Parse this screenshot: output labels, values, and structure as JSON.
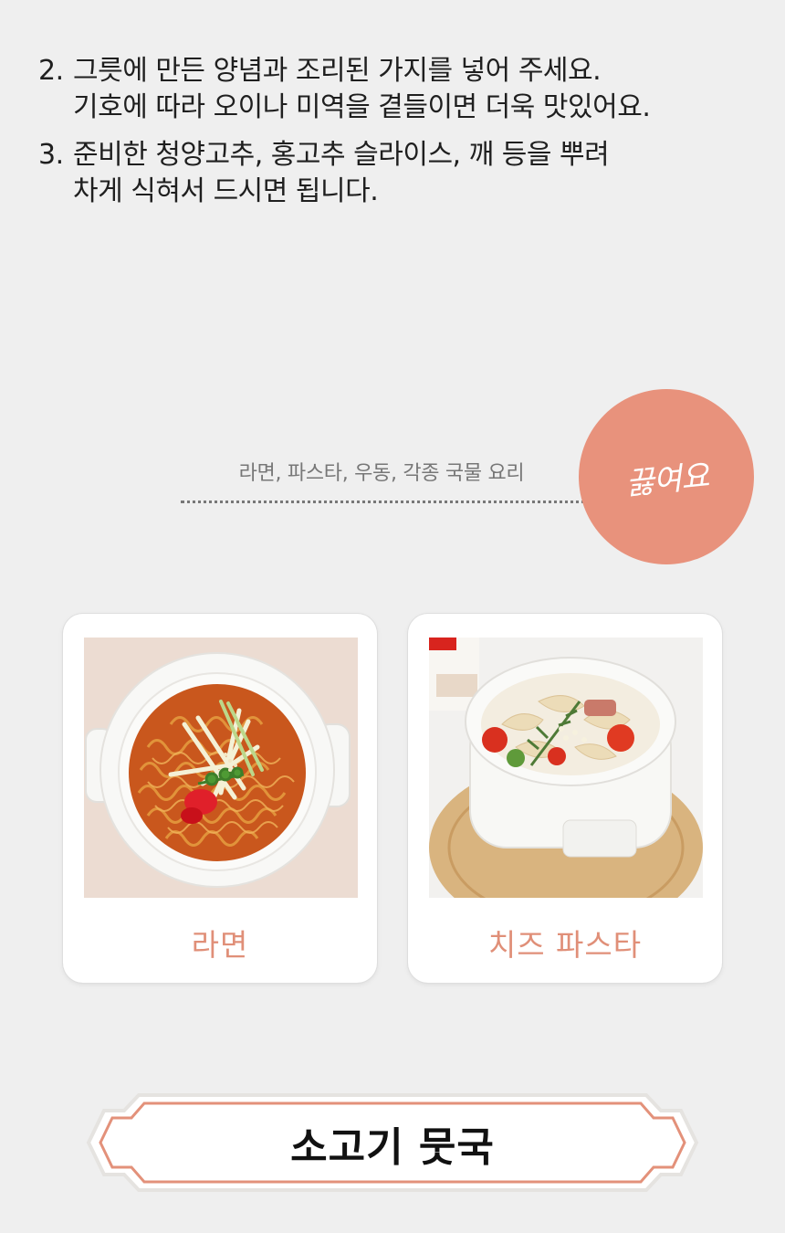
{
  "steps": [
    {
      "number": "2.",
      "lines": [
        "그릇에 만든 양념과 조리된 가지를 넣어 주세요.",
        "기호에 따라 오이나 미역을 곁들이면 더욱 맛있어요."
      ]
    },
    {
      "number": "3.",
      "lines": [
        "준비한 청양고추, 홍고추 슬라이스, 깨 등을 뿌려",
        "차게 식혀서 드시면 됩니다."
      ]
    }
  ],
  "feature": {
    "subtitle": "라면, 파스타, 우동, 각종 국물 요리",
    "badge": "끓여요",
    "badge_color": "#e8927c"
  },
  "cards": [
    {
      "label": "라면",
      "image": "ramen-photo"
    },
    {
      "label": "치즈 파스타",
      "image": "cheese-pasta-photo"
    }
  ],
  "accent_color": "#e08f78",
  "next_section": {
    "title": "소고기 뭇국"
  }
}
